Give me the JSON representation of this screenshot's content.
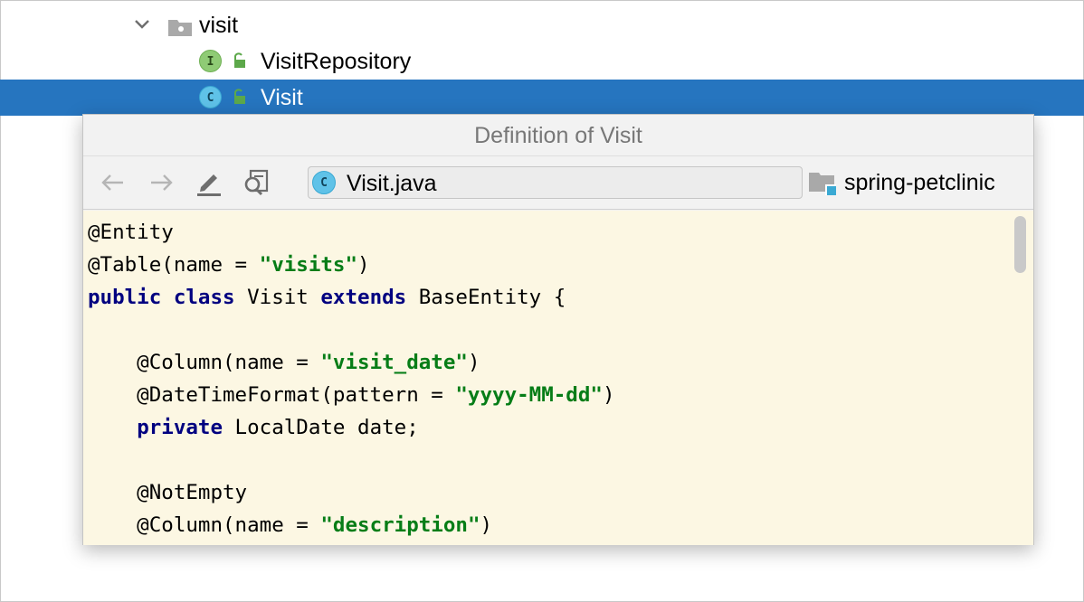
{
  "tree": {
    "folder": {
      "label": "visit",
      "expanded": true,
      "icon": "package-folder-icon"
    },
    "items": [
      {
        "label": "VisitRepository",
        "kind_badge": "I",
        "kind": "interface",
        "selected": false
      },
      {
        "label": "Visit",
        "kind_badge": "C",
        "kind": "class",
        "selected": true
      }
    ]
  },
  "popup": {
    "title": "Definition of Visit",
    "toolbar": {
      "back_icon": "arrow-left-icon",
      "forward_icon": "arrow-right-icon",
      "edit_icon": "pencil-icon",
      "find_usages_icon": "find-usages-icon"
    },
    "file": {
      "badge": "C",
      "name": "Visit.java"
    },
    "module": {
      "name": "spring-petclinic",
      "icon": "module-folder-icon"
    },
    "code_lines": [
      [
        {
          "t": "@Entity",
          "c": "ann"
        }
      ],
      [
        {
          "t": "@Table(name = ",
          "c": "ann"
        },
        {
          "t": "\"visits\"",
          "c": "str"
        },
        {
          "t": ")",
          "c": "ann"
        }
      ],
      [
        {
          "t": "public",
          "c": "kw"
        },
        {
          "t": " ",
          "c": "ann"
        },
        {
          "t": "class",
          "c": "kw"
        },
        {
          "t": " Visit ",
          "c": "ann"
        },
        {
          "t": "extends",
          "c": "kw"
        },
        {
          "t": " BaseEntity {",
          "c": "ann"
        }
      ],
      [],
      [
        {
          "t": "    @Column(name = ",
          "c": "ann"
        },
        {
          "t": "\"visit_date\"",
          "c": "str"
        },
        {
          "t": ")",
          "c": "ann"
        }
      ],
      [
        {
          "t": "    @DateTimeFormat(pattern = ",
          "c": "ann"
        },
        {
          "t": "\"yyyy-MM-dd\"",
          "c": "str"
        },
        {
          "t": ")",
          "c": "ann"
        }
      ],
      [
        {
          "t": "    ",
          "c": "ann"
        },
        {
          "t": "private",
          "c": "kw"
        },
        {
          "t": " LocalDate date;",
          "c": "ann"
        }
      ],
      [],
      [
        {
          "t": "    @NotEmpty",
          "c": "ann"
        }
      ],
      [
        {
          "t": "    @Column(name = ",
          "c": "ann"
        },
        {
          "t": "\"description\"",
          "c": "str"
        },
        {
          "t": ")",
          "c": "ann"
        }
      ]
    ]
  },
  "colors": {
    "selection": "#2675bf",
    "keyword": "#000080",
    "string": "#067d17",
    "code_background": "#fcf7e3"
  }
}
